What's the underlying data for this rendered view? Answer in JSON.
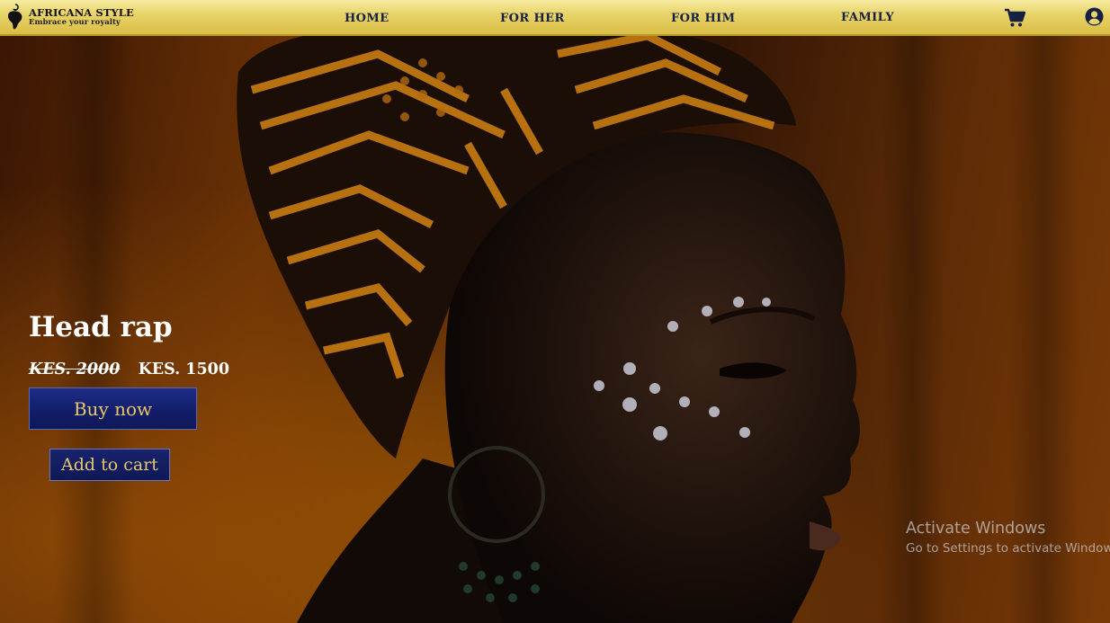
{
  "brand": {
    "name": "AFRICANA STYLE",
    "tagline": "Embrace your royalty",
    "icon": "hanger-africa-icon"
  },
  "nav": {
    "items": [
      {
        "label": "HOME"
      },
      {
        "label": "FOR HER"
      },
      {
        "label": "FOR HIM"
      },
      {
        "label": "FAMILY"
      }
    ],
    "cart_icon": "shopping-cart-icon",
    "account_icon": "user-circle-icon"
  },
  "hero": {
    "title": "Head rap",
    "old_price": "KES. 2000",
    "new_price": "KES. 1500",
    "buy_label": "Buy now",
    "add_to_cart_label": "Add to cart",
    "button_color": "#121d68",
    "button_text_color": "#e7c76c"
  },
  "watermark": {
    "title": "Activate Windows",
    "subtitle": "Go to Settings to activate Windows."
  },
  "colors": {
    "nav_gold": "#e9d46a",
    "nav_text": "#152042",
    "hero_amber": "#9a5504"
  }
}
